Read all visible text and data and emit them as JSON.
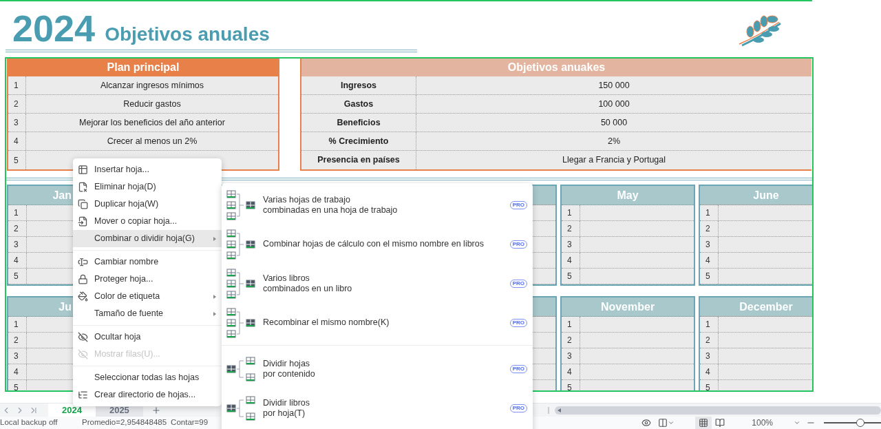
{
  "header": {
    "year": "2024",
    "title": "Objetivos anuales"
  },
  "plan": {
    "title": "Plan principal",
    "rows": [
      {
        "number": "1",
        "text": "Alcanzar ingresos mínimos"
      },
      {
        "number": "2",
        "text": "Reducir gastos"
      },
      {
        "number": "3",
        "text": "Mejorar los beneficios del año anterior"
      },
      {
        "number": "4",
        "text": "Crecer al menos un 2%"
      },
      {
        "number": "5"
      }
    ]
  },
  "goals": {
    "title": "Objetivos anuakes",
    "rows": [
      {
        "label": "Ingresos",
        "value": "150 000"
      },
      {
        "label": "Gastos",
        "value": "100 000"
      },
      {
        "label": "Beneficios",
        "value": "50 000"
      },
      {
        "label": "% Crecimiento",
        "value": "2%"
      },
      {
        "label": "Presencia en países",
        "value": "Llegar a Francia y Portugal"
      }
    ]
  },
  "month_rows": [
    {
      "first": {
        "title": "Jan",
        "numbers": [
          "1",
          "2",
          "3",
          "4",
          "5"
        ]
      },
      "last": [
        {
          "title": "May",
          "numbers": [
            "1",
            "2",
            "3",
            "4",
            "5"
          ]
        },
        {
          "title": "June",
          "numbers": [
            "1",
            "2",
            "3",
            "4",
            "5"
          ]
        }
      ]
    },
    {
      "first": {
        "title": "Ju",
        "numbers": [
          "1",
          "2",
          "3",
          "4",
          "5"
        ]
      },
      "last": [
        {
          "title": "November",
          "numbers": [
            "1",
            "2",
            "3",
            "4",
            "5"
          ]
        },
        {
          "title": "December",
          "numbers": [
            "1",
            "2",
            "3",
            "4",
            "5"
          ]
        }
      ]
    }
  ],
  "context_menu": {
    "groups": [
      [
        {
          "label": "Insertar hoja...",
          "highlighted": false,
          "disabled": false,
          "submenu": false
        },
        {
          "label": "Eliminar hoja(D)",
          "highlighted": false,
          "disabled": false,
          "submenu": false
        },
        {
          "label": "Duplicar hoja(W)",
          "highlighted": false,
          "disabled": false,
          "submenu": false
        },
        {
          "label": "Mover o copiar hoja...",
          "highlighted": false,
          "disabled": false,
          "submenu": false
        },
        {
          "label": "Combinar o dividir hoja(G)",
          "highlighted": true,
          "disabled": false,
          "submenu": true
        }
      ],
      [
        {
          "label": "Cambiar nombre",
          "highlighted": false,
          "disabled": false,
          "submenu": false
        },
        {
          "label": "Proteger hoja...",
          "highlighted": false,
          "disabled": false,
          "submenu": false
        },
        {
          "label": "Color de etiqueta",
          "highlighted": false,
          "disabled": false,
          "submenu": true
        },
        {
          "label": "Tamaño de fuente",
          "highlighted": false,
          "disabled": false,
          "submenu": true
        }
      ],
      [
        {
          "label": "Ocultar hoja",
          "highlighted": false,
          "disabled": false,
          "submenu": false
        },
        {
          "label": "Mostrar filas(U)...",
          "highlighted": false,
          "disabled": true,
          "submenu": false
        }
      ],
      [
        {
          "label": "Seleccionar todas las hojas",
          "highlighted": false,
          "disabled": false,
          "submenu": false
        },
        {
          "label": "Crear directorio de hojas...",
          "highlighted": false,
          "disabled": false,
          "submenu": false
        }
      ]
    ]
  },
  "submenu": {
    "groups": [
      [
        {
          "kind": "merge",
          "lines": [
            "Varias hojas de trabajo",
            "combinadas en una hoja de trabajo"
          ],
          "badge": "PRO"
        },
        {
          "kind": "merge",
          "lines": [
            "Combinar hojas de cálculo con el mismo nombre en libros"
          ],
          "badge": "PRO"
        },
        {
          "kind": "merge",
          "lines": [
            "Varios libros",
            "combinados en un libro"
          ],
          "badge": "PRO"
        },
        {
          "kind": "merge",
          "lines": [
            "Recombinar el mismo nombre(K)"
          ],
          "badge": "PRO"
        }
      ],
      [
        {
          "kind": "split",
          "lines": [
            "Dividir hojas",
            "por contenido"
          ],
          "badge": "PRO"
        },
        {
          "kind": "split",
          "lines": [
            "Dividir libros",
            "por hoja(T)"
          ],
          "badge": "PRO"
        }
      ]
    ]
  },
  "sheet_tabs": [
    {
      "label": "2024",
      "selected": true
    },
    {
      "label": "2025",
      "selected": false
    }
  ],
  "status_bar": {
    "backup": "Local backup off",
    "average": "Promedio=2,954848485",
    "count": "Contar=99",
    "zoom": "100%",
    "view_modes": [
      {
        "kind": "normal",
        "selected": true
      },
      {
        "kind": "page",
        "selected": false
      }
    ],
    "zoom_slider": {
      "level": 0.5
    }
  }
}
